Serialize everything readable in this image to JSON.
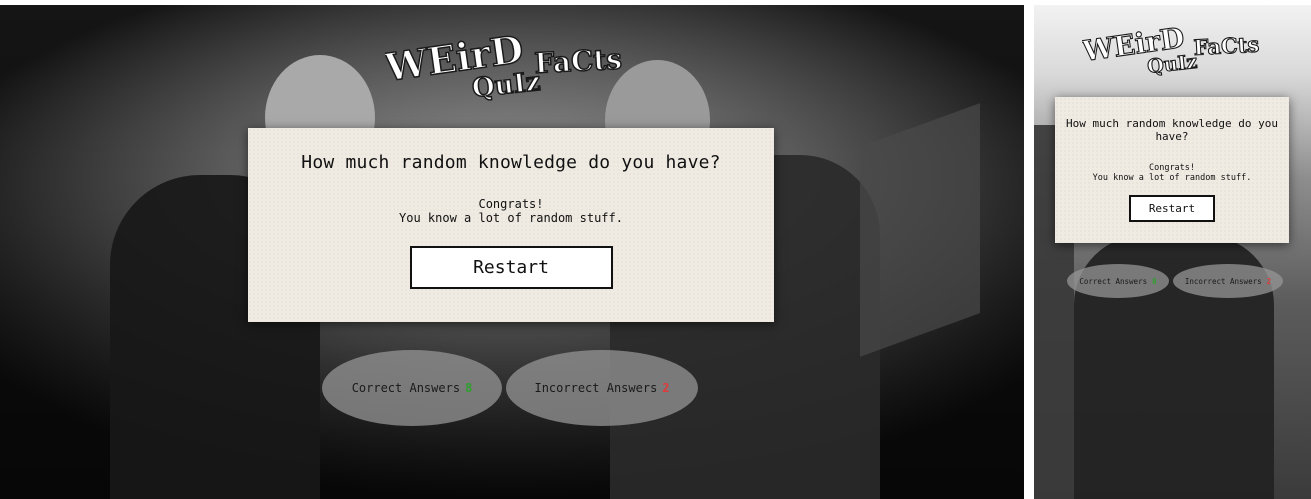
{
  "brand": {
    "logo_words": [
      "WEirD",
      "QuIz",
      "FaCts"
    ]
  },
  "quiz": {
    "question": "How much random knowledge do you have?",
    "result_line1": "Congrats!",
    "result_line2": "You know a lot of random stuff.",
    "restart_label": "Restart"
  },
  "score": {
    "correct_label": "Correct Answers",
    "correct_value": "8",
    "incorrect_label": "Incorrect Answers",
    "incorrect_value": "2"
  },
  "colors": {
    "card": "#efebe2",
    "correct": "#2ea02e",
    "incorrect": "#e03b3b",
    "oval": "#969696"
  }
}
